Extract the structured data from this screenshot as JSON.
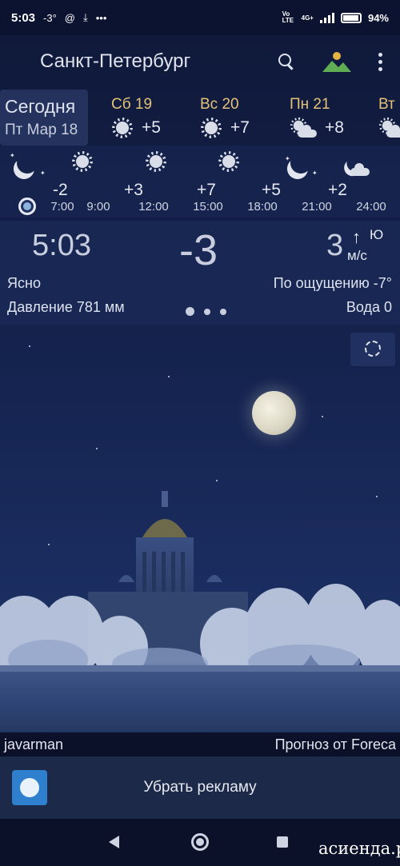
{
  "status_bar": {
    "time": "5:03",
    "notif_temp": "-3°",
    "notif_at": "@",
    "notif_download": "⤓",
    "notif_more": "•••",
    "volte": "Vo LTE",
    "network": "4G+",
    "battery": "94%"
  },
  "header": {
    "city": "Санкт-Петербург",
    "icons": [
      "search-icon",
      "landscape-icon",
      "more-vert-icon"
    ]
  },
  "days": [
    {
      "name": "Сегодня",
      "date": "Пт Мар 18",
      "selected": true
    },
    {
      "name": "Сб 19",
      "icon": "sun-icon",
      "temp": "+5"
    },
    {
      "name": "Вс 20",
      "icon": "sun-icon",
      "temp": "+7"
    },
    {
      "name": "Пн 21",
      "icon": "sun-cloud-icon",
      "temp": "+8"
    },
    {
      "name": "Вт",
      "icon": "sun-cloud-icon",
      "temp": ""
    }
  ],
  "hourly": {
    "temps": [
      "-2",
      "+3",
      "+7",
      "+5",
      "+2"
    ],
    "times": [
      "7:00",
      "9:00",
      "12:00",
      "15:00",
      "18:00",
      "21:00",
      "24:00"
    ],
    "icons": [
      "moon-icon",
      "sun-icon",
      "sun-icon",
      "sun-icon",
      "moon-icon",
      "moon-cloud-icon"
    ]
  },
  "current": {
    "time": "5:03",
    "temp": "-3",
    "wind_speed": "3",
    "wind_arrow": "↑",
    "wind_dir": "Ю",
    "wind_unit": "м/с",
    "condition": "Ясно",
    "feels_like": "По ощущению -7°",
    "pressure": "Давление 781 мм",
    "water": "Вода 0"
  },
  "credits": {
    "author": "javarman",
    "provider": "Прогноз от Foreca"
  },
  "ad": {
    "label": "Убрать рекламу",
    "icon": "smiling-sun-icon"
  },
  "watermark": "асиенда.ру",
  "colors": {
    "accent_day": "#e3c27a",
    "background": "#14224d"
  }
}
